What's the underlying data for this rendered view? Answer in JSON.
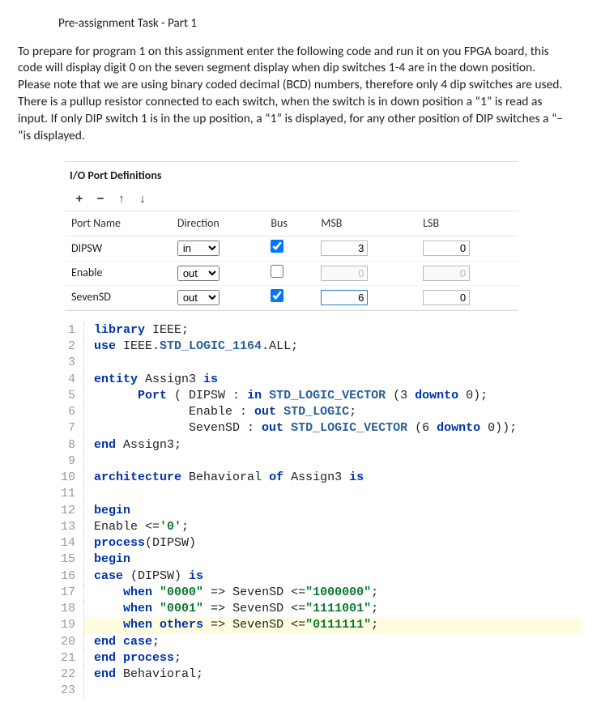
{
  "title": "Pre-assignment Task - Part 1",
  "intro": "To prepare for program 1 on this assignment enter the following code and run it on you FPGA board, this code will display digit 0 on the seven segment display when dip switches 1-4 are in the down position.  Please note that we are using binary coded decimal (BCD) numbers, therefore only 4 dip switches are used.  There is a pullup resistor connected to each switch, when the switch is in down position a “1” is read as input.  If only DIP switch 1 is in the up position, a “1” is displayed, for any other position of DIP switches a “– “is displayed.",
  "io": {
    "section_title": "I/O Port Definitions",
    "toolbar": {
      "add": "+",
      "remove": "−",
      "up": "↑",
      "down": "↓"
    },
    "headers": {
      "name": "Port Name",
      "direction": "Direction",
      "bus": "Bus",
      "msb": "MSB",
      "lsb": "LSB"
    },
    "rows": [
      {
        "name": "DIPSW",
        "dir": "in",
        "bus": true,
        "msb": "3",
        "lsb": "0",
        "disabled": false
      },
      {
        "name": "Enable",
        "dir": "out",
        "bus": false,
        "msb": "0",
        "lsb": "0",
        "disabled": true
      },
      {
        "name": "SevenSD",
        "dir": "out",
        "bus": true,
        "msb": "6",
        "lsb": "0",
        "disabled": false,
        "msb_focus": true
      }
    ]
  },
  "code": [
    {
      "n": "1",
      "tokens": [
        [
          "kw",
          "library"
        ],
        [
          "id",
          " IEEE;"
        ]
      ]
    },
    {
      "n": "2",
      "tokens": [
        [
          "kw",
          "use"
        ],
        [
          "id",
          " IEEE."
        ],
        [
          "type",
          "STD_LOGIC_1164"
        ],
        [
          "id",
          ".ALL;"
        ]
      ]
    },
    {
      "n": "3",
      "tokens": [
        [
          "id",
          ""
        ]
      ]
    },
    {
      "n": "4",
      "tokens": [
        [
          "kw",
          "entity"
        ],
        [
          "id",
          " Assign3 "
        ],
        [
          "kw",
          "is"
        ]
      ]
    },
    {
      "n": "5",
      "tokens": [
        [
          "id",
          "      "
        ],
        [
          "kw",
          "Port"
        ],
        [
          "id",
          " ( DIPSW : "
        ],
        [
          "kw",
          "in"
        ],
        [
          "id",
          " "
        ],
        [
          "type",
          "STD_LOGIC_VECTOR"
        ],
        [
          "id",
          " (3 "
        ],
        [
          "kw",
          "downto"
        ],
        [
          "id",
          " 0);"
        ]
      ]
    },
    {
      "n": "6",
      "tokens": [
        [
          "id",
          "             Enable : "
        ],
        [
          "kw",
          "out"
        ],
        [
          "id",
          " "
        ],
        [
          "type",
          "STD_LOGIC"
        ],
        [
          "id",
          ";"
        ]
      ]
    },
    {
      "n": "7",
      "tokens": [
        [
          "id",
          "             SevenSD : "
        ],
        [
          "kw",
          "out"
        ],
        [
          "id",
          " "
        ],
        [
          "type",
          "STD_LOGIC_VECTOR"
        ],
        [
          "id",
          " (6 "
        ],
        [
          "kw",
          "downto"
        ],
        [
          "id",
          " 0));"
        ]
      ]
    },
    {
      "n": "8",
      "tokens": [
        [
          "kw",
          "end"
        ],
        [
          "id",
          " Assign3;"
        ]
      ]
    },
    {
      "n": "9",
      "tokens": [
        [
          "id",
          ""
        ]
      ]
    },
    {
      "n": "10",
      "tokens": [
        [
          "kw",
          "architecture"
        ],
        [
          "id",
          " Behavioral "
        ],
        [
          "kw",
          "of"
        ],
        [
          "id",
          " Assign3 "
        ],
        [
          "kw",
          "is"
        ]
      ]
    },
    {
      "n": "11",
      "tokens": [
        [
          "id",
          ""
        ]
      ]
    },
    {
      "n": "12",
      "tokens": [
        [
          "kw",
          "begin"
        ]
      ]
    },
    {
      "n": "13",
      "tokens": [
        [
          "id",
          "Enable <="
        ],
        [
          "str",
          "'0'"
        ],
        [
          "id",
          ";"
        ]
      ]
    },
    {
      "n": "14",
      "tokens": [
        [
          "kw",
          "process"
        ],
        [
          "id",
          "(DIPSW)"
        ]
      ]
    },
    {
      "n": "15",
      "tokens": [
        [
          "kw",
          "begin"
        ]
      ]
    },
    {
      "n": "16",
      "tokens": [
        [
          "kw",
          "case"
        ],
        [
          "id",
          " (DIPSW) "
        ],
        [
          "kw",
          "is"
        ]
      ]
    },
    {
      "n": "17",
      "tokens": [
        [
          "id",
          "    "
        ],
        [
          "kw",
          "when"
        ],
        [
          "id",
          " "
        ],
        [
          "str",
          "\"0000\""
        ],
        [
          "id",
          " => SevenSD <="
        ],
        [
          "str",
          "\"1000000\""
        ],
        [
          "id",
          ";"
        ]
      ]
    },
    {
      "n": "18",
      "tokens": [
        [
          "id",
          "    "
        ],
        [
          "kw",
          "when"
        ],
        [
          "id",
          " "
        ],
        [
          "str",
          "\"0001\""
        ],
        [
          "id",
          " => SevenSD <="
        ],
        [
          "str",
          "\"1111001\""
        ],
        [
          "id",
          ";"
        ]
      ]
    },
    {
      "n": "19",
      "hl": true,
      "tokens": [
        [
          "id",
          "    "
        ],
        [
          "kw",
          "when"
        ],
        [
          "id",
          " "
        ],
        [
          "kw",
          "others"
        ],
        [
          "id",
          " => SevenSD <="
        ],
        [
          "str",
          "\"0111111\""
        ],
        [
          "id",
          ";"
        ]
      ]
    },
    {
      "n": "20",
      "tokens": [
        [
          "kw",
          "end"
        ],
        [
          "id",
          " "
        ],
        [
          "kw",
          "case"
        ],
        [
          "id",
          ";"
        ]
      ]
    },
    {
      "n": "21",
      "tokens": [
        [
          "kw",
          "end"
        ],
        [
          "id",
          " "
        ],
        [
          "kw",
          "process"
        ],
        [
          "id",
          ";"
        ]
      ]
    },
    {
      "n": "22",
      "tokens": [
        [
          "kw",
          "end"
        ],
        [
          "id",
          " Behavioral;"
        ]
      ]
    },
    {
      "n": "23",
      "tokens": [
        [
          "id",
          ""
        ]
      ]
    }
  ]
}
